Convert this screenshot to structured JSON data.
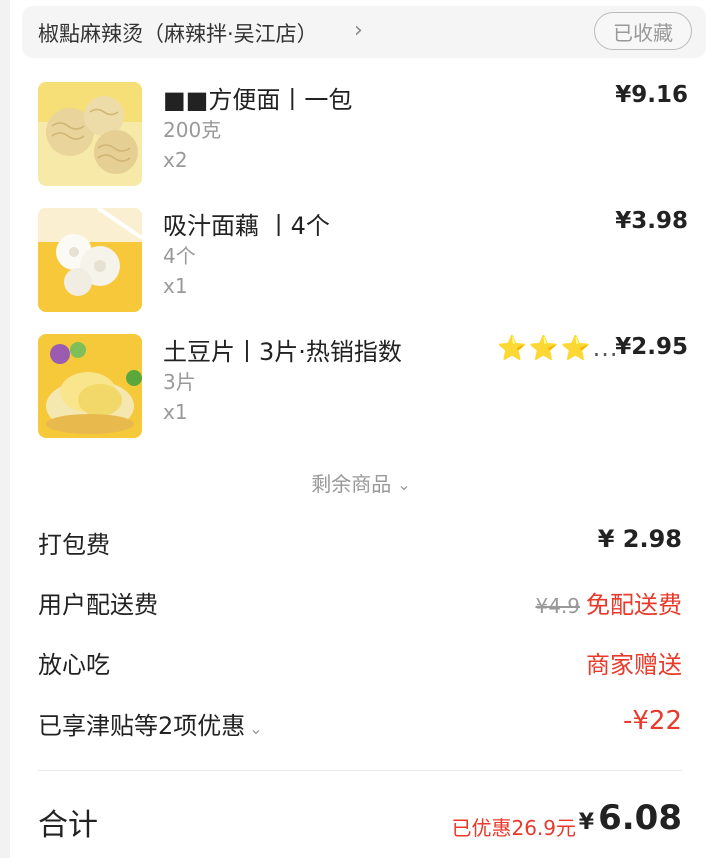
{
  "store": {
    "name": "椒點麻辣烫（麻辣拌·吴江店）",
    "favorite_label": "已收藏"
  },
  "items": [
    {
      "name": "■■方便面丨一包",
      "spec": "200克",
      "qty": "x2",
      "price": "¥9.16"
    },
    {
      "name": "吸汁面藕 丨4个",
      "spec": "4个",
      "qty": "x1",
      "price": "¥3.98"
    },
    {
      "name": "土豆片丨3片·热销指数",
      "spec": "3片",
      "qty": "x1",
      "price": "¥2.95",
      "stars": "⭐⭐⭐",
      "stars_ellipsis": "..."
    }
  ],
  "more_items_label": "剩余商品",
  "fees": {
    "packing": {
      "label": "打包费",
      "value": "¥ 2.98"
    },
    "delivery": {
      "label": "用户配送费",
      "original": "¥4.9",
      "value": "免配送费"
    },
    "assurance": {
      "label": "放心吃",
      "value": "商家赠送"
    },
    "discount": {
      "label": "已享津贴等2项优惠",
      "value": "-¥22"
    }
  },
  "total": {
    "label": "合计",
    "saved": "已优惠26.9元",
    "currency": "¥",
    "amount": "6.08"
  },
  "colors": {
    "accent_red": "#e8392a",
    "star": "#f5b80b"
  }
}
